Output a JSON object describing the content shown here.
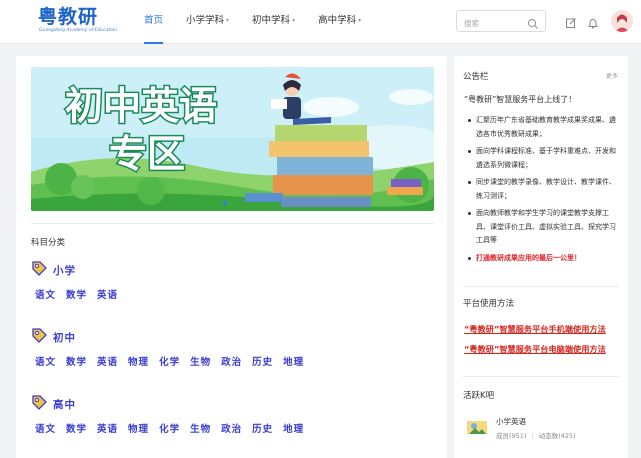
{
  "header": {
    "logo": "粤教研",
    "logo_subtitle": "Guangdong Academy of Education",
    "nav": [
      {
        "label": "首页",
        "active": true,
        "has_caret": false
      },
      {
        "label": "小学学科",
        "active": false,
        "has_caret": true
      },
      {
        "label": "初中学科",
        "active": false,
        "has_caret": true
      },
      {
        "label": "高中学科",
        "active": false,
        "has_caret": true
      }
    ],
    "search_placeholder": "搜索",
    "accent_color": "#2f7ae5",
    "icons": [
      "search-icon",
      "edit-icon",
      "bell-icon",
      "user-avatar"
    ]
  },
  "banner": {
    "line1": "初中英语",
    "line2": "专区"
  },
  "main": {
    "section_title": "科目分类",
    "subjects": [
      {
        "name": "小学",
        "items": [
          "语文",
          "数学",
          "英语"
        ]
      },
      {
        "name": "初中",
        "items": [
          "语文",
          "数学",
          "英语",
          "物理",
          "化学",
          "生物",
          "政治",
          "历史",
          "地理"
        ]
      },
      {
        "name": "高中",
        "items": [
          "语文",
          "数学",
          "英语",
          "物理",
          "化学",
          "生物",
          "政治",
          "历史",
          "地理"
        ]
      }
    ],
    "subject_color": "#3b3fd2"
  },
  "sidebar": {
    "notice": {
      "title": "公告栏",
      "more": "更多",
      "headline": "“粤教研”智慧服务平台上线了！",
      "bullets": [
        "汇聚历年广东省基础教育教学成果奖成果、遴选各市优秀教研成果；",
        "面向学科课程标准、基于学科重难点、开发和遴选系列微课程；",
        "同步课堂的教学录像、教学设计、教学课件、练习测评；",
        "面向教师教学和学生学习的课堂教学支撑工具、课堂评价工具、虚拟实验工具、探究学习工具等",
        "打通教研成果应用的最后一公里！"
      ]
    },
    "guide": {
      "title": "平台使用方法",
      "links": [
        "“粤教研”智慧服务平台手机端使用方法",
        "“粤教研”智慧服务平台电脑端使用方法"
      ]
    },
    "active_bars": {
      "title": "活跃K吧",
      "items": [
        {
          "name": "小学英语",
          "members": "成员(951)",
          "posts": "动态数(425)"
        }
      ]
    },
    "link_color": "#d3261f"
  }
}
